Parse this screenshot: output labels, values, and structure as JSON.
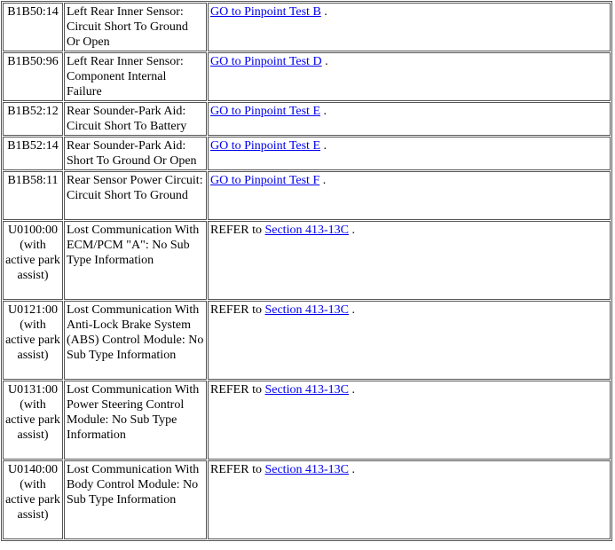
{
  "rows": [
    {
      "code": "B1B50:14",
      "description": "Left Rear Inner Sensor: Circuit Short To Ground Or Open",
      "action_prefix": "",
      "link": "GO to Pinpoint Test B",
      "suffix": " ."
    },
    {
      "code": "B1B50:96",
      "description": "Left Rear Inner Sensor: Component Internal Failure",
      "action_prefix": "",
      "link": "GO to Pinpoint Test D",
      "suffix": " ."
    },
    {
      "code": "B1B52:12",
      "description": "Rear Sounder-Park Aid: Circuit Short To Battery",
      "action_prefix": "",
      "link": "GO to Pinpoint Test E",
      "suffix": " ."
    },
    {
      "code": "B1B52:14",
      "description": "Rear Sounder-Park Aid: Short To Ground Or Open",
      "action_prefix": "",
      "link": "GO to Pinpoint Test E",
      "suffix": " ."
    },
    {
      "code": "B1B58:11",
      "description": "Rear Sensor Power Circuit: Circuit Short To Ground",
      "action_prefix": "",
      "link": "GO to Pinpoint Test F",
      "suffix": " ."
    },
    {
      "code": "U0100:00 (with active park assist)",
      "description": "Lost Communication With ECM/PCM \"A\": No Sub Type Information",
      "action_prefix": "REFER to ",
      "link": "Section 413-13C",
      "suffix": " ."
    },
    {
      "code": "U0121:00 (with active park assist)",
      "description": "Lost Communication With Anti-Lock Brake System (ABS) Control Module: No Sub Type Information",
      "action_prefix": "REFER to ",
      "link": "Section 413-13C",
      "suffix": " ."
    },
    {
      "code": "U0131:00 (with active park assist)",
      "description": "Lost Communication With Power Steering Control Module: No Sub Type Information",
      "action_prefix": "REFER to ",
      "link": "Section 413-13C",
      "suffix": " ."
    },
    {
      "code": "U0140:00 (with active park assist)",
      "description": "Lost Communication With Body Control Module: No Sub Type Information",
      "action_prefix": "REFER to ",
      "link": "Section 413-13C",
      "suffix": " ."
    }
  ]
}
